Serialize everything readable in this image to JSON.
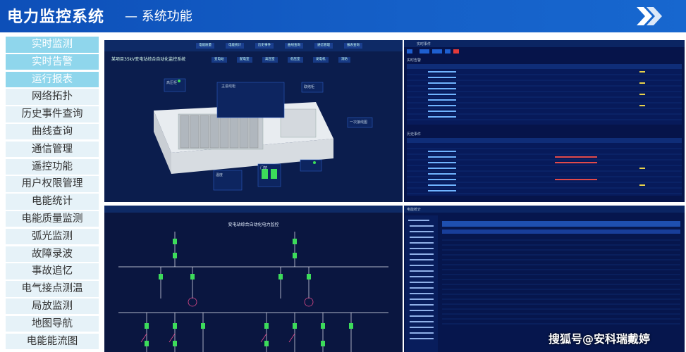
{
  "header": {
    "title": "电力监控系统",
    "subtitle": "—  系统功能"
  },
  "sidebar": {
    "items": [
      {
        "label": "实时监测"
      },
      {
        "label": "实时告警"
      },
      {
        "label": "运行报表"
      },
      {
        "label": "网络拓扑"
      },
      {
        "label": "历史事件查询"
      },
      {
        "label": "曲线查询"
      },
      {
        "label": "通信管理"
      },
      {
        "label": "遥控功能"
      },
      {
        "label": "用户权限管理"
      },
      {
        "label": "电能统计"
      },
      {
        "label": "电能质量监测"
      },
      {
        "label": "弧光监测"
      },
      {
        "label": "故障录波"
      },
      {
        "label": "事故追忆"
      },
      {
        "label": "电气接点测温"
      },
      {
        "label": "局放监测"
      },
      {
        "label": "地图导航"
      },
      {
        "label": "电能能流图"
      }
    ]
  },
  "panel1": {
    "title": "某项目35kV变电站综合自动化监控系统",
    "nav": [
      "电能质量",
      "电能统计",
      "历史事件",
      "曲线查询",
      "通信管理",
      "报表查询"
    ],
    "subtabs": [
      "变电站",
      "配电室",
      "高压室",
      "低压室",
      "发电机",
      "消防"
    ],
    "labels": {
      "main_box": "主进线柜",
      "high_cabinet": "高压柜",
      "contact_cabinet": "联络柜",
      "transformer": "一次接线图",
      "temp": "温度",
      "door": "门禁"
    }
  },
  "panel2": {
    "title": "实时事件",
    "section1": "实时告警",
    "section2": "历史事件"
  },
  "panel3": {
    "title": "变电站综合自动化电力监控"
  },
  "panel4": {
    "title": "电能统计"
  },
  "watermark": "搜狐号@安科瑞戴婷",
  "colors": {
    "header_bg": "#1560c8",
    "sidebar_active": "#8fd6ec",
    "sidebar_item": "#e6f2f8",
    "panel_bg": "#0b1d4d"
  }
}
